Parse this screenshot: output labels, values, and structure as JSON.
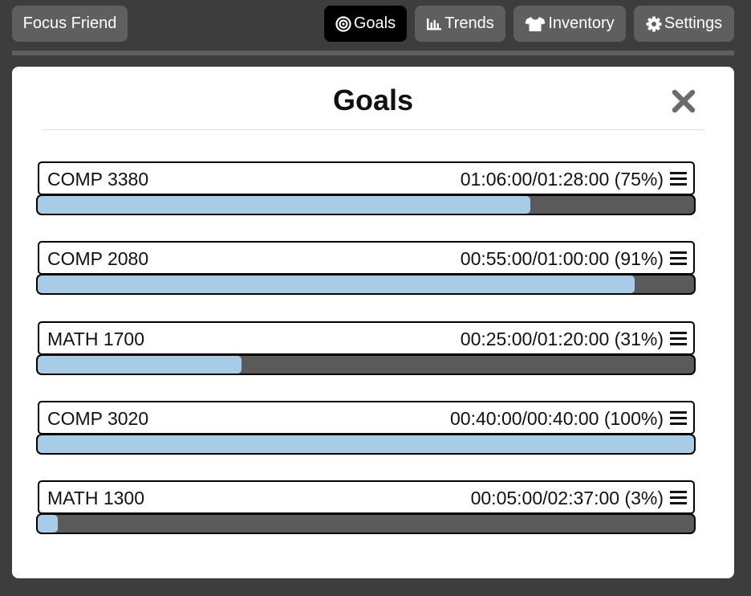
{
  "nav": {
    "brand": "Focus Friend",
    "goals": "Goals",
    "trends": "Trends",
    "inventory": "Inventory",
    "settings": "Settings"
  },
  "modal": {
    "title": "Goals"
  },
  "goals": [
    {
      "name": "COMP 3380",
      "time": "01:06:00/01:28:00 (75%)",
      "progress": 0.75
    },
    {
      "name": "COMP 2080",
      "time": "00:55:00/01:00:00 (91%)",
      "progress": 0.91
    },
    {
      "name": "MATH 1700",
      "time": "00:25:00/01:20:00 (31%)",
      "progress": 0.31
    },
    {
      "name": "COMP 3020",
      "time": "00:40:00/00:40:00 (100%)",
      "progress": 1.0
    },
    {
      "name": "MATH 1300",
      "time": "00:05:00/02:37:00 (3%)",
      "progress": 0.03
    }
  ],
  "colors": {
    "progress_fill": "#a6cce8",
    "progress_track": "#5a5a5a",
    "active_tab": "#000000",
    "tab": "#5f5f5f"
  }
}
